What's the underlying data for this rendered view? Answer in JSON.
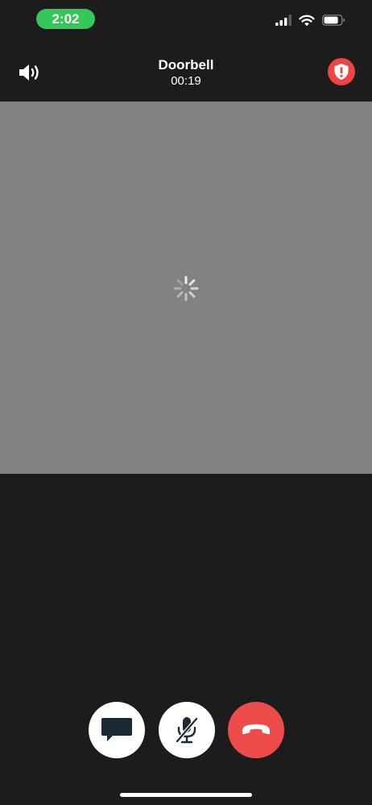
{
  "status_bar": {
    "time": "2:02",
    "time_pill_color": "#34c759",
    "icons": [
      "cellular-signal-icon",
      "wifi-icon",
      "battery-icon"
    ]
  },
  "header": {
    "title": "Doorbell",
    "duration": "00:19",
    "left_icon": "speaker-icon",
    "right_icon": "shield-alert-icon",
    "alert_color": "#ee4343"
  },
  "video": {
    "state": "loading",
    "icon": "loading-spinner-icon",
    "background_color": "#828282"
  },
  "controls": [
    {
      "name": "message",
      "icon": "chat-bubble-icon",
      "background_color": "#ffffff"
    },
    {
      "name": "mute",
      "icon": "microphone-off-icon",
      "background_color": "#ffffff"
    },
    {
      "name": "end-call",
      "icon": "hang-up-icon",
      "background_color": "#ee4b4b"
    }
  ]
}
